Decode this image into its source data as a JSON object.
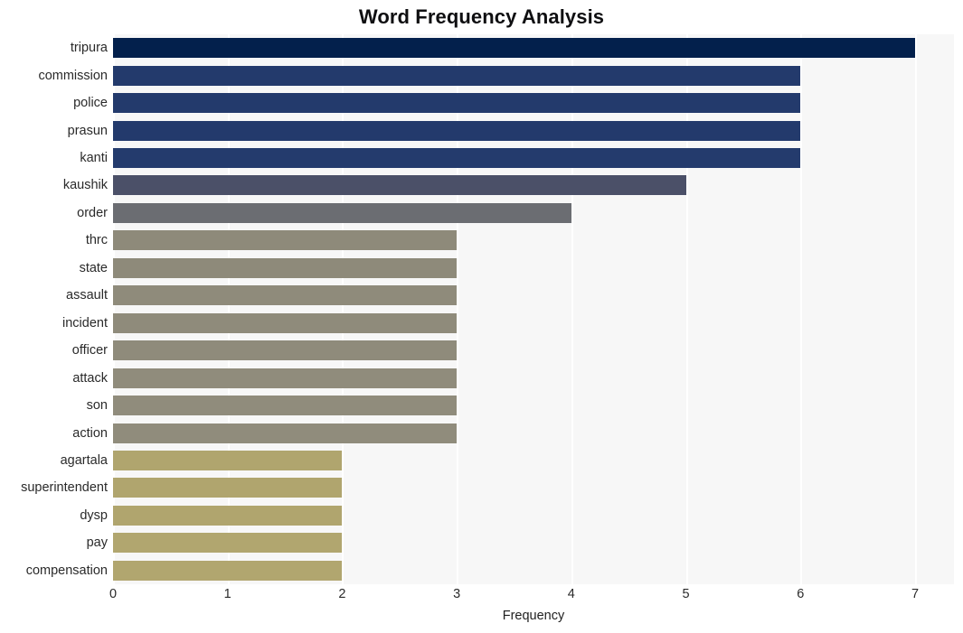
{
  "chart_data": {
    "type": "bar",
    "orientation": "horizontal",
    "title": "Word Frequency Analysis",
    "xlabel": "Frequency",
    "ylabel": "",
    "xlim": [
      0,
      7
    ],
    "xticks": [
      0,
      1,
      2,
      3,
      4,
      5,
      6,
      7
    ],
    "xtick_labels": [
      "0",
      "1",
      "2",
      "3",
      "4",
      "5",
      "6",
      "7"
    ],
    "grid": true,
    "grid_axis": "x",
    "grid_color": "#ffffff",
    "plot_background": "#f7f7f7",
    "figure_background": "#ffffff",
    "legend": null,
    "categories": [
      "tripura",
      "commission",
      "police",
      "prasun",
      "kanti",
      "kaushik",
      "order",
      "thrc",
      "state",
      "assault",
      "incident",
      "officer",
      "attack",
      "son",
      "action",
      "agartala",
      "superintendent",
      "dysp",
      "pay",
      "compensation"
    ],
    "values": [
      7,
      6,
      6,
      6,
      6,
      5,
      4,
      3,
      3,
      3,
      3,
      3,
      3,
      3,
      3,
      2,
      2,
      2,
      2,
      2
    ],
    "bar_colors": [
      "#03204c",
      "#233a6c",
      "#233a6c",
      "#233a6c",
      "#243b6d",
      "#4b5068",
      "#6b6d72",
      "#8e8a7a",
      "#8e8a7a",
      "#8f8b7b",
      "#8f8b7b",
      "#8f8b7b",
      "#908c7c",
      "#908c7c",
      "#908c7c",
      "#b0a56e",
      "#b0a56e",
      "#b0a56e",
      "#b1a66f",
      "#b1a66f"
    ]
  }
}
